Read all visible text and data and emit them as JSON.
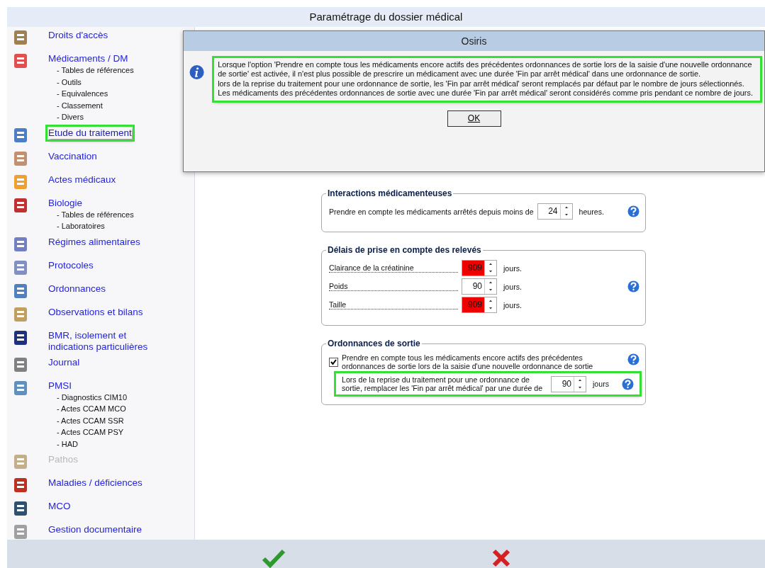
{
  "window": {
    "title": "Paramétrage du dossier médical"
  },
  "sidebar": {
    "items": [
      {
        "label": "Droits d'accès",
        "selected": false,
        "disabled": false,
        "highlighted": false
      },
      {
        "label": "Médicaments / DM",
        "selected": false,
        "disabled": false,
        "highlighted": false,
        "children": [
          {
            "label": "- Tables de références"
          },
          {
            "label": "- Outils"
          },
          {
            "label": "- Equivalences"
          },
          {
            "label": "- Classement"
          },
          {
            "label": "- Divers"
          }
        ]
      },
      {
        "label": "Etude du traitement",
        "selected": true,
        "disabled": false,
        "highlighted": true
      },
      {
        "label": "Vaccination",
        "selected": false,
        "disabled": false,
        "highlighted": false
      },
      {
        "label": "Actes médicaux",
        "selected": false,
        "disabled": false,
        "highlighted": false
      },
      {
        "label": "Biologie",
        "selected": false,
        "disabled": false,
        "highlighted": false,
        "children": [
          {
            "label": "- Tables de références"
          },
          {
            "label": "- Laboratoires"
          }
        ]
      },
      {
        "label": "Régimes alimentaires",
        "selected": false,
        "disabled": false,
        "highlighted": false
      },
      {
        "label": "Protocoles",
        "selected": false,
        "disabled": false,
        "highlighted": false
      },
      {
        "label": "Ordonnances",
        "selected": false,
        "disabled": false,
        "highlighted": false
      },
      {
        "label": "Observations et bilans",
        "selected": false,
        "disabled": false,
        "highlighted": false
      },
      {
        "label": "BMR, isolement et indications particulières",
        "selected": false,
        "disabled": false,
        "highlighted": false
      },
      {
        "label": "Journal",
        "selected": false,
        "disabled": false,
        "highlighted": false
      },
      {
        "label": "PMSI",
        "selected": false,
        "disabled": false,
        "highlighted": false,
        "children": [
          {
            "label": "- Diagnostics CIM10"
          },
          {
            "label": "- Actes CCAM MCO"
          },
          {
            "label": "- Actes CCAM SSR"
          },
          {
            "label": "- Actes CCAM PSY"
          },
          {
            "label": "- HAD"
          }
        ]
      },
      {
        "label": "Pathos",
        "selected": false,
        "disabled": true,
        "highlighted": false
      },
      {
        "label": "Maladies / déficiences",
        "selected": false,
        "disabled": false,
        "highlighted": false
      },
      {
        "label": "MCO",
        "selected": false,
        "disabled": false,
        "highlighted": false
      },
      {
        "label": "Gestion documentaire",
        "selected": false,
        "disabled": false,
        "highlighted": false
      }
    ]
  },
  "groups": [
    {
      "title": "Interactions médicamenteuses",
      "rows": [
        {
          "kind": "inline",
          "label": "Prendre en compte les médicaments arrêtés depuis moins de",
          "value": "24",
          "invalid": false,
          "unit": "heures.",
          "help": true
        }
      ]
    },
    {
      "title": "Délais de prise en compte des relevés",
      "rows": [
        {
          "kind": "dotted",
          "label": "Clairance de la créatinine",
          "value": "909",
          "invalid": true,
          "unit": "jours.",
          "help": false
        },
        {
          "kind": "dotted",
          "label": "Poids",
          "value": "90",
          "invalid": false,
          "unit": "jours.",
          "help": true
        },
        {
          "kind": "dotted",
          "label": "Taille",
          "value": "909",
          "invalid": true,
          "unit": "jours.",
          "help": false
        }
      ]
    },
    {
      "title": "Ordonnances de sortie",
      "rows": [
        {
          "kind": "checkbox",
          "label": "Prendre en compte tous les médicaments encore actifs des précédentes ordonnances de sortie lors de la saisie d'une nouvelle ordonnance de sortie",
          "checked": true,
          "help": true
        },
        {
          "kind": "spin",
          "label": "Lors de la reprise du traitement pour une ordonnance de sortie, remplacer les 'Fin par arrêt médical' par une durée de",
          "value": "90",
          "invalid": false,
          "unit": "jours",
          "help": true,
          "highlighted": true
        }
      ]
    }
  ],
  "dialog": {
    "title": "Osiris",
    "message": [
      "Lorsque l'option 'Prendre en compte tous les médicaments encore actifs des précédentes ordonnances de sortie lors de la saisie d'une nouvelle ordonnance de sortie' est activée, il n'est plus possible de prescrire un médicament avec une durée 'Fin par arrêt médical' dans une ordonnance de sortie.",
      "lors de la reprise du traitement pour une ordonnance de sortie, les 'Fin par arrêt médical' seront remplacés par défaut par le nombre de jours sélectionnés.",
      "Les médicaments des précédentes ordonnances de sortie avec une durée 'Fin par arrêt médical' seront considérés comme pris pendant ce nombre de jours."
    ],
    "highlighted": true,
    "button": "OK"
  }
}
